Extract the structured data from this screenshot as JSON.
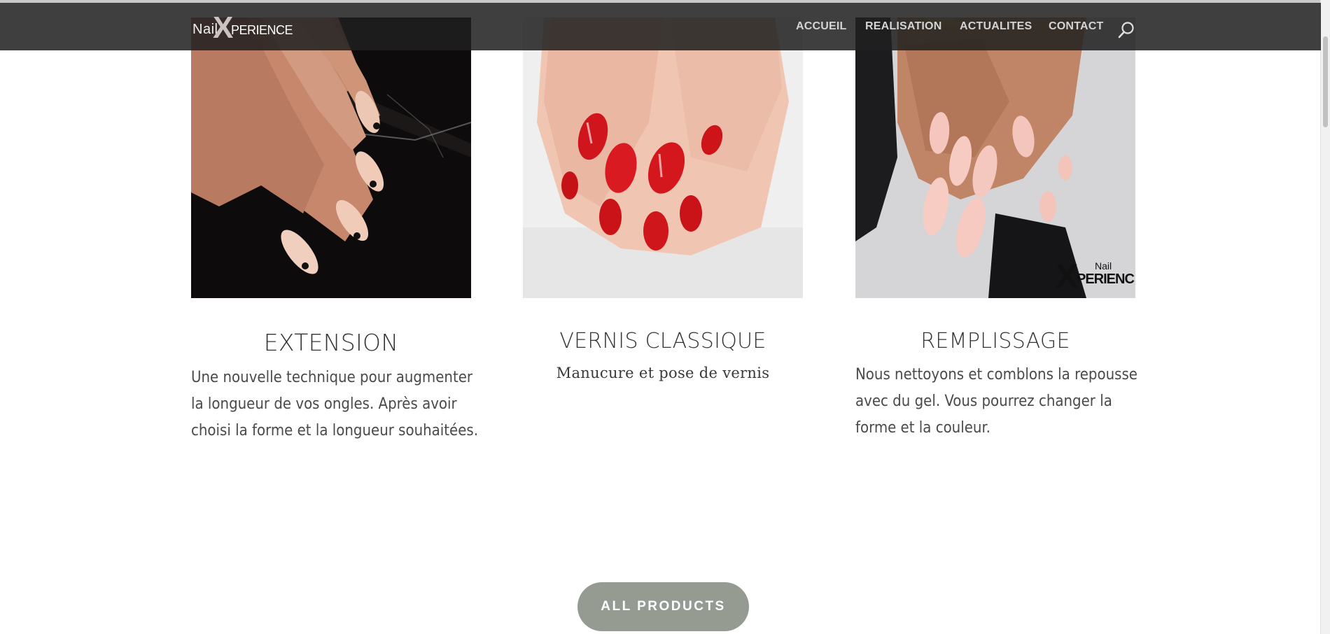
{
  "header": {
    "logo": {
      "nail": "Nail",
      "x": "X",
      "perience": "PERIENCE"
    },
    "nav": [
      "ACCUEIL",
      "REALISATION",
      "ACTUALITES",
      "CONTACT"
    ],
    "search_icon": "search-icon"
  },
  "products": [
    {
      "title": "EXTENSION",
      "description": "Une nouvelle technique pour augmenter la longueur de vos ongles. Après avoir choisi la forme et la longueur souhaitées.",
      "image": "nude nails with black hearts on dark marble"
    },
    {
      "title": "VERNIS CLASSIQUE",
      "description": "Manucure et pose de vernis",
      "image": "red polished nails on white towel"
    },
    {
      "title": "REMPLISSAGE",
      "description": "Nous nettoyons et comblons la repousse avec du gel. Vous pourrez changer la forme et la couleur.",
      "image": "pale pink long nails",
      "watermark": "Nail XPERIENC"
    }
  ],
  "cta": {
    "label": "ALL PRODUCTS"
  },
  "colors": {
    "header_bg": "#202020",
    "button_bg": "#969b92",
    "text": "#333333"
  }
}
